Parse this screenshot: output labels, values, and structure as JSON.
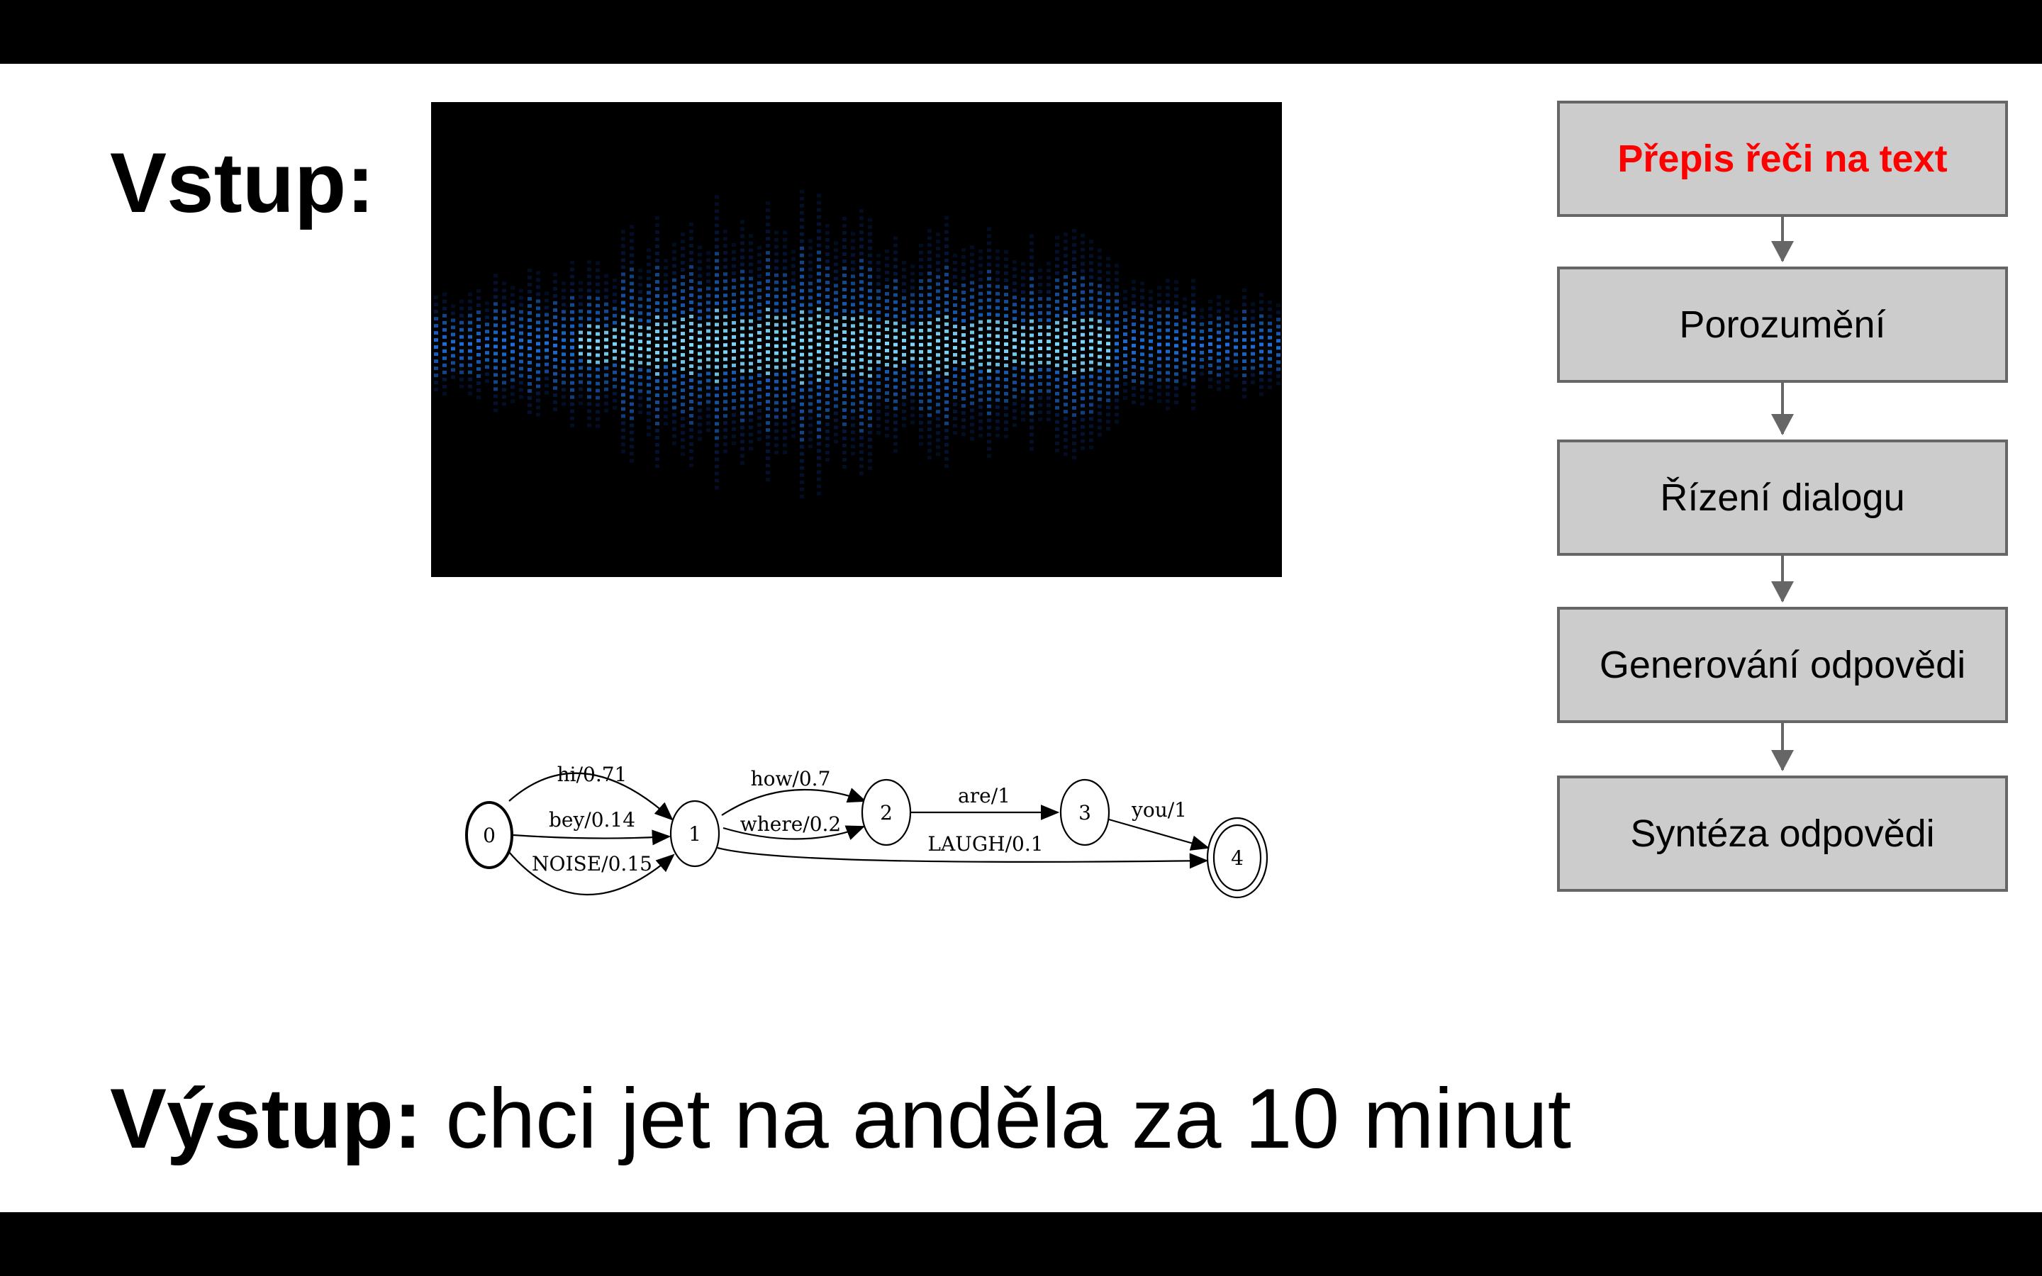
{
  "slide": {
    "input_label": "Vstup:",
    "output_label": "Výstup:",
    "output_text": "chci jet na anděla za 10 minut"
  },
  "pipeline": {
    "stages": [
      {
        "label": "Přepis řeči na text",
        "active": true
      },
      {
        "label": "Porozumění",
        "active": false
      },
      {
        "label": "Řízení dialogu",
        "active": false
      },
      {
        "label": "Generování odpovědi",
        "active": false
      },
      {
        "label": "Syntéza odpovědi",
        "active": false
      }
    ],
    "active_color": "#ff0000",
    "box_fill": "#cccccc",
    "box_border": "#666666"
  },
  "wfst": {
    "states": [
      "0",
      "1",
      "2",
      "3",
      "4"
    ],
    "edges": [
      {
        "from": "0",
        "to": "1",
        "label": "hi/0.71"
      },
      {
        "from": "0",
        "to": "1",
        "label": "bey/0.14"
      },
      {
        "from": "0",
        "to": "1",
        "label": "NOISE/0.15"
      },
      {
        "from": "1",
        "to": "2",
        "label": "how/0.7"
      },
      {
        "from": "1",
        "to": "2",
        "label": "where/0.2"
      },
      {
        "from": "1",
        "to": "4",
        "label": "LAUGH/0.1"
      },
      {
        "from": "2",
        "to": "3",
        "label": "are/1"
      },
      {
        "from": "3",
        "to": "4",
        "label": "you/1"
      }
    ],
    "start_state": "0",
    "final_state": "4"
  },
  "waveform": {
    "icon": "audio-waveform-image",
    "colors": [
      "#0a2a6e",
      "#1e6fd9",
      "#7fd8ff"
    ]
  }
}
